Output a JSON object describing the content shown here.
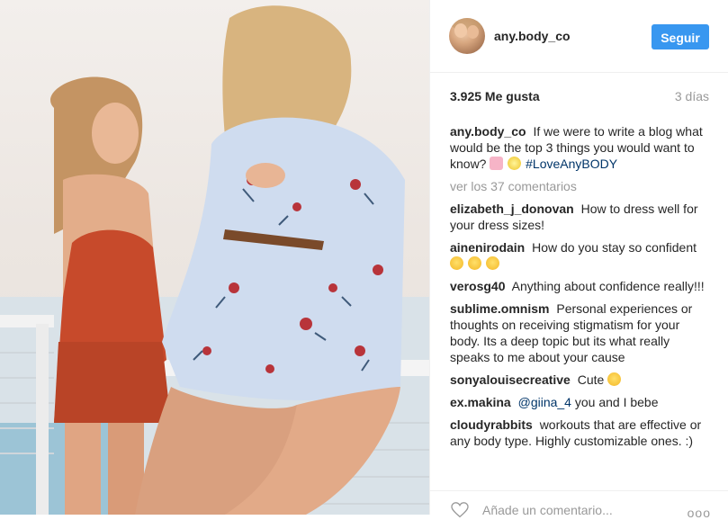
{
  "post": {
    "image_alt": "",
    "username": "any.body_co",
    "follow_label": "Seguir",
    "likes": "3.925 Me gusta",
    "time": "3 días",
    "view_all": "ver los 37 comentarios",
    "input_placeholder": "Añade un comentario...",
    "more": "ooo",
    "accent_color": "#3897f0"
  },
  "caption": {
    "user": "any.body_co",
    "text": "If we were to write a blog what would be the top 3 things you would want to know?",
    "hashtag": "#LoveAnyBODY"
  },
  "comments": [
    {
      "user": "elizabeth_j_donovan",
      "text": "How to dress well for your dress sizes!"
    },
    {
      "user": "ainenirodain",
      "text": "How do you stay so confident"
    },
    {
      "user": "verosg40",
      "text": "Anything about confidence really!!!"
    },
    {
      "user": "sublime.omnism",
      "text": "Personal experiences or thoughts on receiving stigmatism for your body. Its a deep topic but its what really speaks to me about your cause"
    },
    {
      "user": "sonyalouisecreative",
      "text": "Cute"
    },
    {
      "user": "ex.makina",
      "mention": "@giina_4",
      "text": "you and I bebe"
    },
    {
      "user": "cloudyrabbits",
      "text": "workouts that are effective or any body type. Highly customizable ones. :)"
    }
  ]
}
